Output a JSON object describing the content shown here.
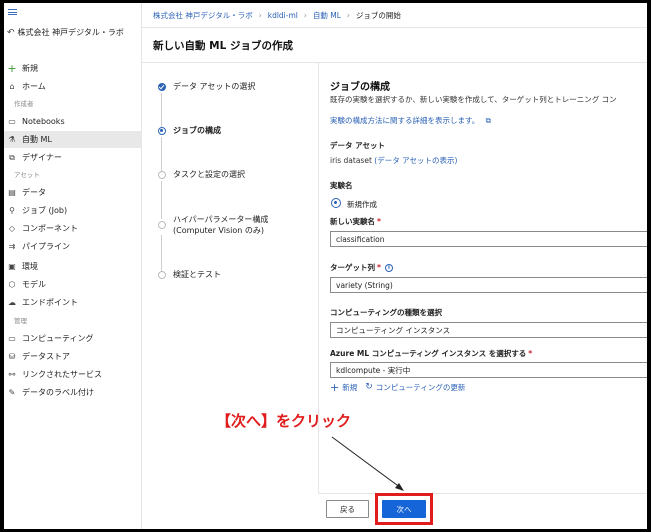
{
  "sidebar": {
    "workspace_name": "株式会社 神戸デジタル・ラボ",
    "items": [
      {
        "label": "新規",
        "icon": "plus-icon",
        "active": false
      },
      {
        "label": "ホーム",
        "icon": "home-icon",
        "active": false
      },
      {
        "label": "Notebooks",
        "icon": "notebook-icon",
        "active": false
      },
      {
        "label": "自動 ML",
        "icon": "automl-icon",
        "active": true
      },
      {
        "label": "デザイナー",
        "icon": "designer-icon",
        "active": false
      },
      {
        "label": "データ",
        "icon": "data-icon",
        "active": false
      },
      {
        "label": "ジョブ (Job)",
        "icon": "job-icon",
        "active": false
      },
      {
        "label": "コンポーネント",
        "icon": "component-icon",
        "active": false
      },
      {
        "label": "パイプライン",
        "icon": "pipeline-icon",
        "active": false
      },
      {
        "label": "環境",
        "icon": "environment-icon",
        "active": false
      },
      {
        "label": "モデル",
        "icon": "model-icon",
        "active": false
      },
      {
        "label": "エンドポイント",
        "icon": "endpoint-icon",
        "active": false
      },
      {
        "label": "コンピューティング",
        "icon": "compute-icon",
        "active": false
      },
      {
        "label": "データストア",
        "icon": "datastore-icon",
        "active": false
      },
      {
        "label": "リンクされたサービス",
        "icon": "linked-service-icon",
        "active": false
      },
      {
        "label": "データのラベル付け",
        "icon": "data-labeling-icon",
        "active": false
      }
    ],
    "sections": {
      "author": "作成者",
      "assets": "アセット",
      "manage": "管理"
    }
  },
  "breadcrumb": [
    "株式会社 神戸デジタル・ラボ",
    "kdldi-ml",
    "自動 ML",
    "ジョブの開始"
  ],
  "page_title": "新しい自動 ML ジョブの作成",
  "steps": [
    {
      "label": "データ アセットの選択",
      "state": "done"
    },
    {
      "label": "ジョブの構成",
      "state": "current"
    },
    {
      "label": "タスクと設定の選択",
      "state": "pending"
    },
    {
      "label": "ハイパーパラメーター構成",
      "label2": "(Computer Vision のみ)",
      "state": "pending"
    },
    {
      "label": "検証とテスト",
      "state": "pending"
    }
  ],
  "form": {
    "heading": "ジョブの構成",
    "description": "既存の実験を選択するか、新しい実験を作成して、ターゲット列とトレーニング コン",
    "more_link": "実験の構成方法に関する詳細を表示します。",
    "data_asset_label": "データ アセット",
    "data_asset_value": "iris dataset",
    "data_asset_link": "(データ アセットの表示)",
    "experiment_label": "実験名",
    "new_option_label": "新規作成",
    "new_experiment_label": "新しい実験名",
    "new_experiment_value": "classification",
    "target_label": "ターゲット列",
    "target_value": "variety (String)",
    "compute_type_label": "コンピューティングの種類を選択",
    "compute_type_value": "コンピューティング インスタンス",
    "instance_label": "Azure ML コンピューティング インスタンス を選択する",
    "instance_value": "kdlcompute - 実行中",
    "new_action": "新規",
    "refresh_action": "コンピューティングの更新"
  },
  "buttons": {
    "back": "戻る",
    "next": "次へ"
  },
  "annotation": "【次へ】をクリック",
  "colors": {
    "accent": "#1565d8",
    "link": "#2b62b6",
    "annotation": "#e01c1c"
  }
}
